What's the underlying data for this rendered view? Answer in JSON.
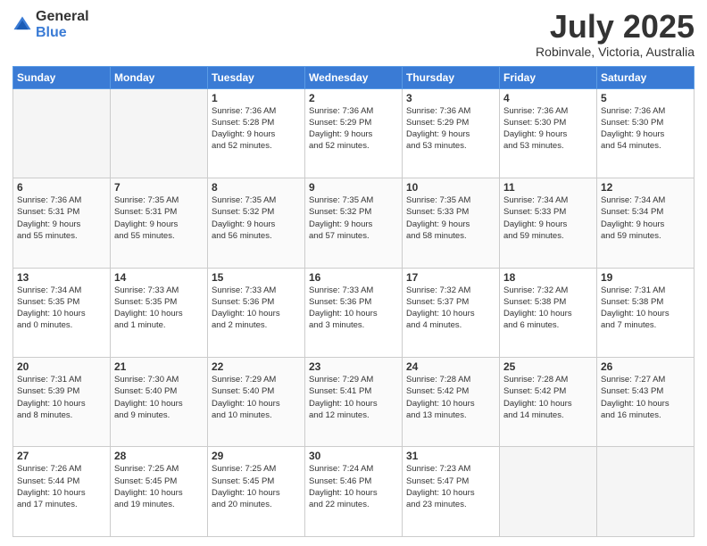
{
  "header": {
    "logo_general": "General",
    "logo_blue": "Blue",
    "month_year": "July 2025",
    "location": "Robinvale, Victoria, Australia"
  },
  "days_of_week": [
    "Sunday",
    "Monday",
    "Tuesday",
    "Wednesday",
    "Thursday",
    "Friday",
    "Saturday"
  ],
  "weeks": [
    [
      {
        "day": "",
        "info": ""
      },
      {
        "day": "",
        "info": ""
      },
      {
        "day": "1",
        "info": "Sunrise: 7:36 AM\nSunset: 5:28 PM\nDaylight: 9 hours\nand 52 minutes."
      },
      {
        "day": "2",
        "info": "Sunrise: 7:36 AM\nSunset: 5:29 PM\nDaylight: 9 hours\nand 52 minutes."
      },
      {
        "day": "3",
        "info": "Sunrise: 7:36 AM\nSunset: 5:29 PM\nDaylight: 9 hours\nand 53 minutes."
      },
      {
        "day": "4",
        "info": "Sunrise: 7:36 AM\nSunset: 5:30 PM\nDaylight: 9 hours\nand 53 minutes."
      },
      {
        "day": "5",
        "info": "Sunrise: 7:36 AM\nSunset: 5:30 PM\nDaylight: 9 hours\nand 54 minutes."
      }
    ],
    [
      {
        "day": "6",
        "info": "Sunrise: 7:36 AM\nSunset: 5:31 PM\nDaylight: 9 hours\nand 55 minutes."
      },
      {
        "day": "7",
        "info": "Sunrise: 7:35 AM\nSunset: 5:31 PM\nDaylight: 9 hours\nand 55 minutes."
      },
      {
        "day": "8",
        "info": "Sunrise: 7:35 AM\nSunset: 5:32 PM\nDaylight: 9 hours\nand 56 minutes."
      },
      {
        "day": "9",
        "info": "Sunrise: 7:35 AM\nSunset: 5:32 PM\nDaylight: 9 hours\nand 57 minutes."
      },
      {
        "day": "10",
        "info": "Sunrise: 7:35 AM\nSunset: 5:33 PM\nDaylight: 9 hours\nand 58 minutes."
      },
      {
        "day": "11",
        "info": "Sunrise: 7:34 AM\nSunset: 5:33 PM\nDaylight: 9 hours\nand 59 minutes."
      },
      {
        "day": "12",
        "info": "Sunrise: 7:34 AM\nSunset: 5:34 PM\nDaylight: 9 hours\nand 59 minutes."
      }
    ],
    [
      {
        "day": "13",
        "info": "Sunrise: 7:34 AM\nSunset: 5:35 PM\nDaylight: 10 hours\nand 0 minutes."
      },
      {
        "day": "14",
        "info": "Sunrise: 7:33 AM\nSunset: 5:35 PM\nDaylight: 10 hours\nand 1 minute."
      },
      {
        "day": "15",
        "info": "Sunrise: 7:33 AM\nSunset: 5:36 PM\nDaylight: 10 hours\nand 2 minutes."
      },
      {
        "day": "16",
        "info": "Sunrise: 7:33 AM\nSunset: 5:36 PM\nDaylight: 10 hours\nand 3 minutes."
      },
      {
        "day": "17",
        "info": "Sunrise: 7:32 AM\nSunset: 5:37 PM\nDaylight: 10 hours\nand 4 minutes."
      },
      {
        "day": "18",
        "info": "Sunrise: 7:32 AM\nSunset: 5:38 PM\nDaylight: 10 hours\nand 6 minutes."
      },
      {
        "day": "19",
        "info": "Sunrise: 7:31 AM\nSunset: 5:38 PM\nDaylight: 10 hours\nand 7 minutes."
      }
    ],
    [
      {
        "day": "20",
        "info": "Sunrise: 7:31 AM\nSunset: 5:39 PM\nDaylight: 10 hours\nand 8 minutes."
      },
      {
        "day": "21",
        "info": "Sunrise: 7:30 AM\nSunset: 5:40 PM\nDaylight: 10 hours\nand 9 minutes."
      },
      {
        "day": "22",
        "info": "Sunrise: 7:29 AM\nSunset: 5:40 PM\nDaylight: 10 hours\nand 10 minutes."
      },
      {
        "day": "23",
        "info": "Sunrise: 7:29 AM\nSunset: 5:41 PM\nDaylight: 10 hours\nand 12 minutes."
      },
      {
        "day": "24",
        "info": "Sunrise: 7:28 AM\nSunset: 5:42 PM\nDaylight: 10 hours\nand 13 minutes."
      },
      {
        "day": "25",
        "info": "Sunrise: 7:28 AM\nSunset: 5:42 PM\nDaylight: 10 hours\nand 14 minutes."
      },
      {
        "day": "26",
        "info": "Sunrise: 7:27 AM\nSunset: 5:43 PM\nDaylight: 10 hours\nand 16 minutes."
      }
    ],
    [
      {
        "day": "27",
        "info": "Sunrise: 7:26 AM\nSunset: 5:44 PM\nDaylight: 10 hours\nand 17 minutes."
      },
      {
        "day": "28",
        "info": "Sunrise: 7:25 AM\nSunset: 5:45 PM\nDaylight: 10 hours\nand 19 minutes."
      },
      {
        "day": "29",
        "info": "Sunrise: 7:25 AM\nSunset: 5:45 PM\nDaylight: 10 hours\nand 20 minutes."
      },
      {
        "day": "30",
        "info": "Sunrise: 7:24 AM\nSunset: 5:46 PM\nDaylight: 10 hours\nand 22 minutes."
      },
      {
        "day": "31",
        "info": "Sunrise: 7:23 AM\nSunset: 5:47 PM\nDaylight: 10 hours\nand 23 minutes."
      },
      {
        "day": "",
        "info": ""
      },
      {
        "day": "",
        "info": ""
      }
    ]
  ]
}
